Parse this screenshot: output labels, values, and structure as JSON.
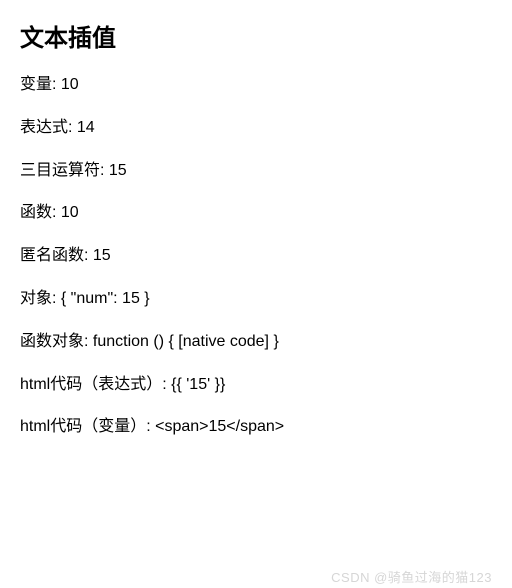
{
  "heading": "文本插值",
  "lines": [
    "变量: 10",
    "表达式: 14",
    "三目运算符: 15",
    "函数: 10",
    "匿名函数: 15",
    "对象: { \"num\": 15 }",
    "函数对象: function () { [native code] }",
    "html代码（表达式）: {{ '15' }}",
    "html代码（变量）: <span>15</span>"
  ],
  "watermark": "CSDN @骑鱼过海的猫123"
}
